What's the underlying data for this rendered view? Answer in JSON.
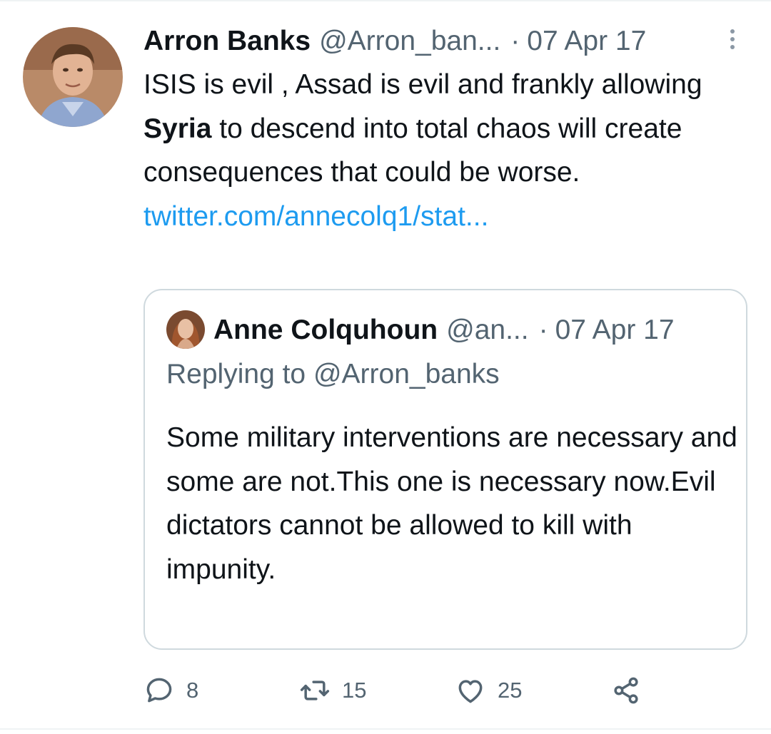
{
  "tweet": {
    "author_name": "Arron Banks",
    "handle": "@Arron_ban...",
    "separator": "·",
    "date": "07 Apr 17",
    "text_part1": "ISIS is evil , Assad is evil and frankly allowing ",
    "text_bold": "Syria",
    "text_part2": " to descend into total chaos will create consequences that could be worse. ",
    "link_text": "twitter.com/annecolq1/stat..."
  },
  "quoted_tweet": {
    "author_name": "Anne Colquhoun",
    "handle": "@an...",
    "separator": "·",
    "date": "07 Apr 17",
    "replying_to": "Replying to @Arron_banks",
    "text": "Some military interventions are necessary and some are not.This one is necessary now.Evil dictators cannot be allowed to kill with impunity."
  },
  "actions": {
    "reply_count": "8",
    "retweet_count": "15",
    "like_count": "25"
  },
  "icons": {
    "more": "more-vertical-icon",
    "reply": "speech-bubble-icon",
    "retweet": "retweet-arrows-icon",
    "like": "heart-icon",
    "share": "share-nodes-icon"
  },
  "colors": {
    "link": "#1d9bf0",
    "secondary_text": "#536471",
    "primary_text": "#0f1419",
    "border": "#cfd9de"
  }
}
